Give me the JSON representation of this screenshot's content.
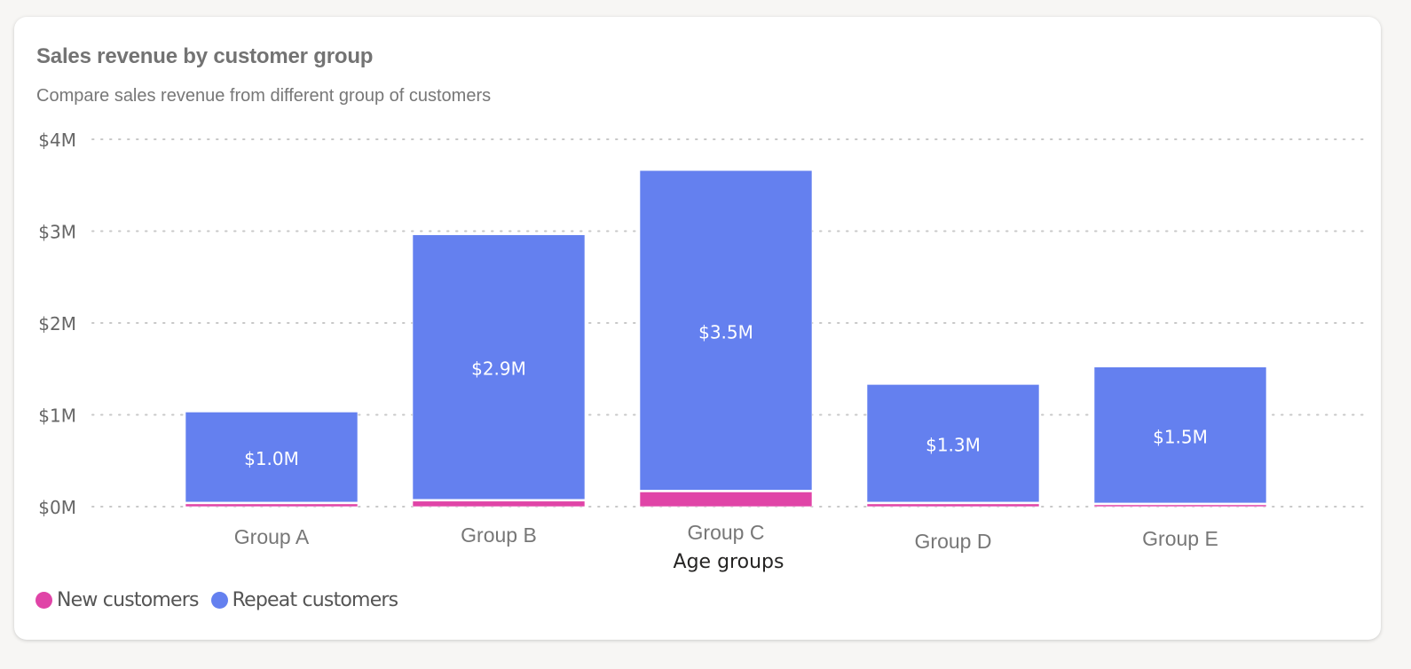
{
  "card": {
    "title": "Sales revenue by customer group",
    "subtitle": "Compare sales revenue from different group of customers"
  },
  "colors": {
    "new": "#e044a7",
    "repeat": "#6480ef",
    "grid": "#c8c8c8",
    "tick_text": "#666666",
    "category_text": "#777777",
    "axis_title": "#252423"
  },
  "chart_data": {
    "type": "bar",
    "stacked": true,
    "title": "Sales revenue by customer group",
    "subtitle": "Compare sales revenue from different group of customers",
    "xlabel": "Age groups",
    "ylabel": "",
    "categories": [
      "Group A",
      "Group B",
      "Group C",
      "Group D",
      "Group E"
    ],
    "series": [
      {
        "name": "New customers",
        "color": "#e044a7",
        "values": [
          0.03,
          0.06,
          0.16,
          0.03,
          0.02
        ]
      },
      {
        "name": "Repeat customers",
        "color": "#6480ef",
        "values": [
          1.0,
          2.9,
          3.5,
          1.3,
          1.5
        ]
      }
    ],
    "data_labels": [
      "$1.0M",
      "$2.9M",
      "$3.5M",
      "$1.3M",
      "$1.5M"
    ],
    "ylim": [
      0,
      4
    ],
    "yticks": [
      0,
      1,
      2,
      3,
      4
    ],
    "ytick_labels": [
      "$0M",
      "$1M",
      "$2M",
      "$3M",
      "$4M"
    ],
    "grid": true,
    "legend": "bottom-left",
    "units": "USD millions"
  }
}
